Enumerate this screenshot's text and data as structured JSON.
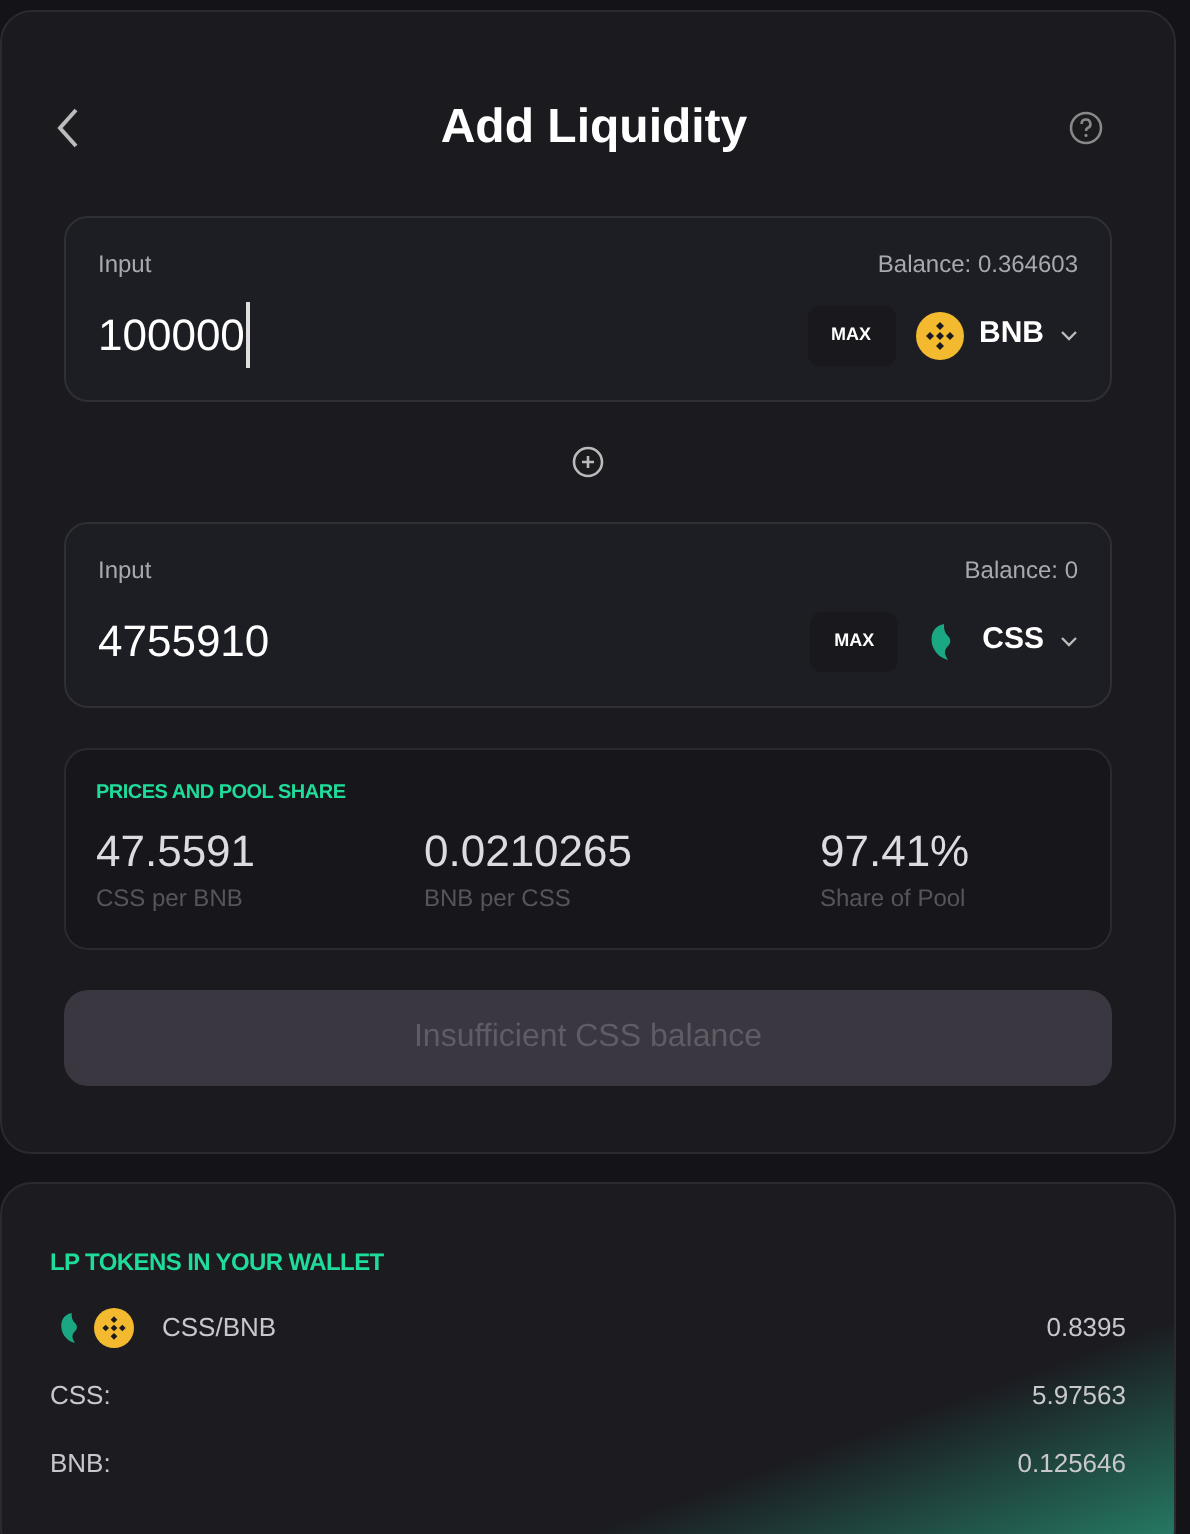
{
  "header": {
    "title": "Add Liquidity"
  },
  "inputs": [
    {
      "label": "Input",
      "balance": "Balance: 0.364603",
      "value": "100000",
      "focused": true,
      "max": "MAX",
      "token": {
        "symbol": "BNB",
        "kind": "bnb"
      }
    },
    {
      "label": "Input",
      "balance": "Balance: 0",
      "value": "4755910",
      "focused": false,
      "max": "MAX",
      "token": {
        "symbol": "CSS",
        "kind": "css"
      }
    }
  ],
  "prices": {
    "title": "PRICES AND POOL SHARE",
    "items": [
      {
        "value": "47.5591",
        "caption": "CSS per BNB"
      },
      {
        "value": "0.0210265",
        "caption": "BNB per CSS"
      },
      {
        "value": "97.41%",
        "caption": "Share of Pool"
      }
    ]
  },
  "submit": {
    "label": "Insufficient CSS balance",
    "disabled": true
  },
  "lp": {
    "title": "LP TOKENS IN YOUR WALLET",
    "pair": {
      "tokens": [
        {
          "kind": "css"
        },
        {
          "kind": "bnb"
        }
      ],
      "label": "CSS/BNB",
      "value": "0.8395"
    },
    "rows": [
      {
        "label": "CSS:",
        "value": "5.97563"
      },
      {
        "label": "BNB:",
        "value": "0.125646"
      }
    ]
  }
}
